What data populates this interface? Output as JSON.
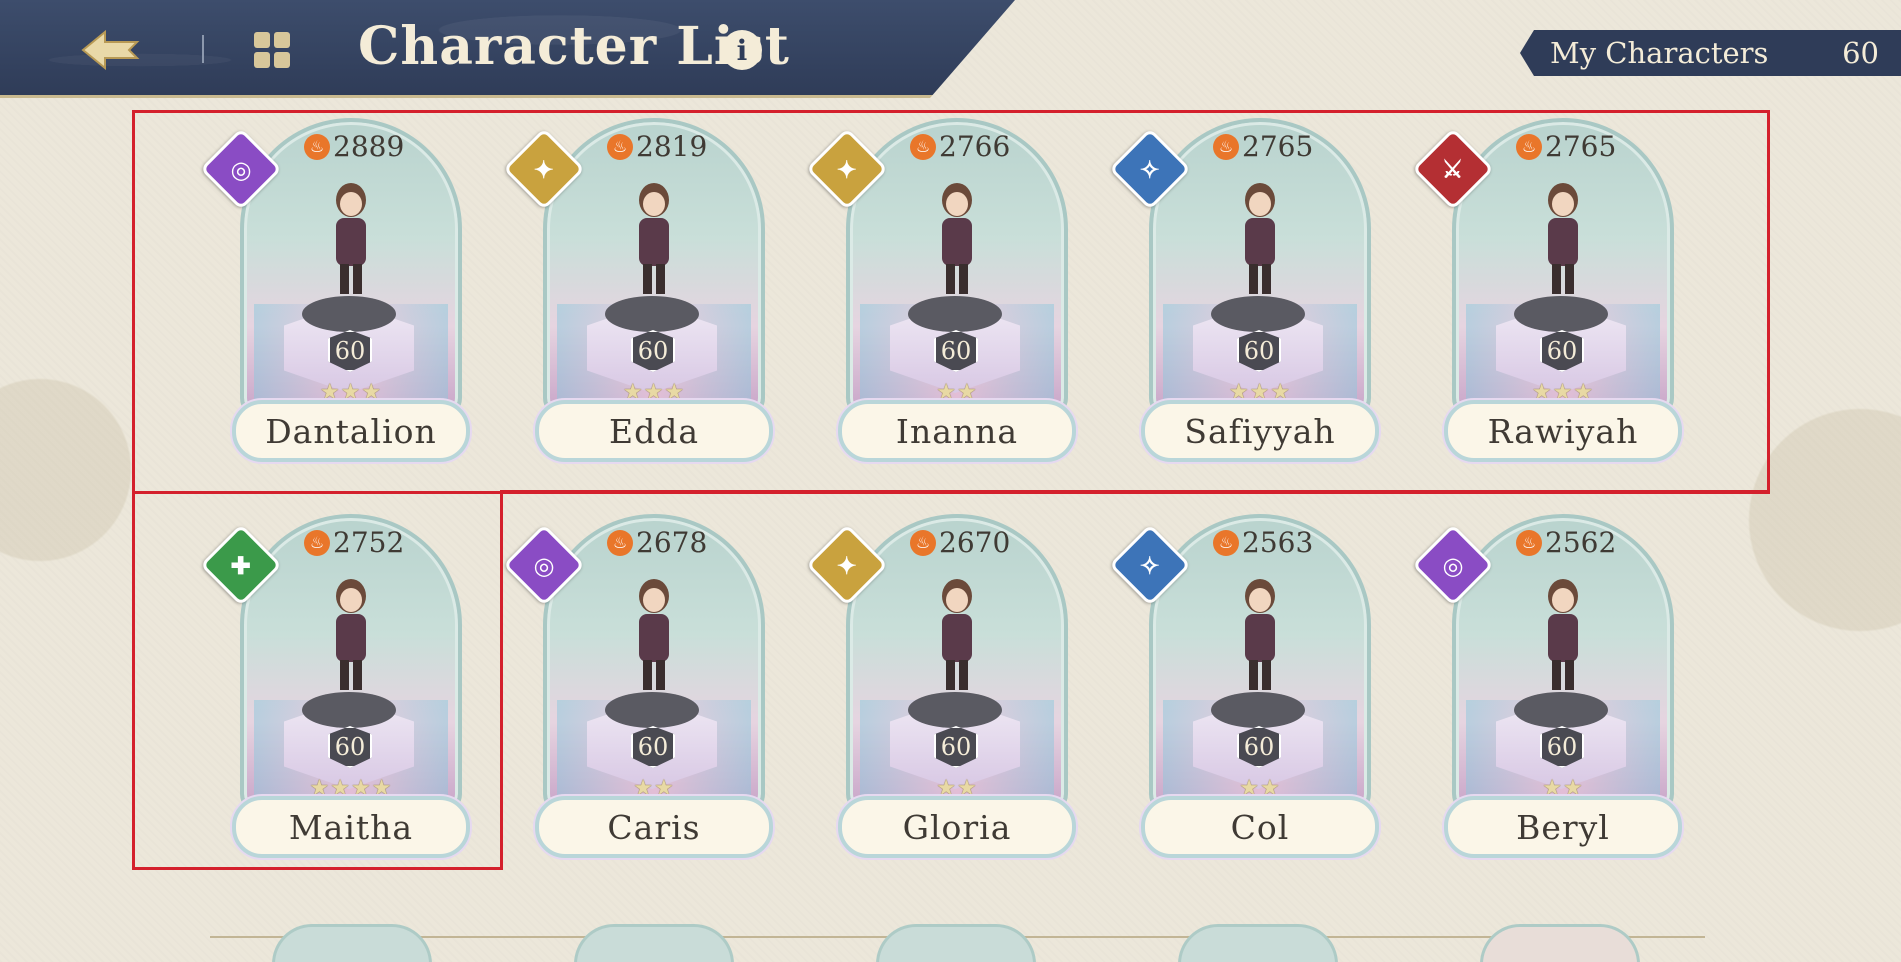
{
  "header": {
    "title": "Character List",
    "info_icon": "i"
  },
  "my_characters": {
    "label": "My Characters",
    "count": "60"
  },
  "colors": {
    "header": "#2f3c58",
    "highlight": "#d4202c",
    "element_purple": "#8a4cc4",
    "element_gold": "#c9a23e",
    "element_blue": "#3d74b8",
    "element_red": "#b42f33",
    "element_green": "#3b9a4a"
  },
  "characters": [
    {
      "name": "Dantalion",
      "power": "2889",
      "level": "60",
      "stars": "★★★",
      "element": "purple"
    },
    {
      "name": "Edda",
      "power": "2819",
      "level": "60",
      "stars": "★★★",
      "element": "gold"
    },
    {
      "name": "Inanna",
      "power": "2766",
      "level": "60",
      "stars": "★★",
      "element": "gold"
    },
    {
      "name": "Safiyyah",
      "power": "2765",
      "level": "60",
      "stars": "★★★",
      "element": "blue"
    },
    {
      "name": "Rawiyah",
      "power": "2765",
      "level": "60",
      "stars": "★★★",
      "element": "red"
    },
    {
      "name": "Maitha",
      "power": "2752",
      "level": "60",
      "stars": "★★★★",
      "element": "green"
    },
    {
      "name": "Caris",
      "power": "2678",
      "level": "60",
      "stars": "★★",
      "element": "purple"
    },
    {
      "name": "Gloria",
      "power": "2670",
      "level": "60",
      "stars": "★★",
      "element": "gold"
    },
    {
      "name": "Col",
      "power": "2563",
      "level": "60",
      "stars": "★★",
      "element": "blue"
    },
    {
      "name": "Beryl",
      "power": "2562",
      "level": "60",
      "stars": "★★",
      "element": "purple"
    }
  ]
}
